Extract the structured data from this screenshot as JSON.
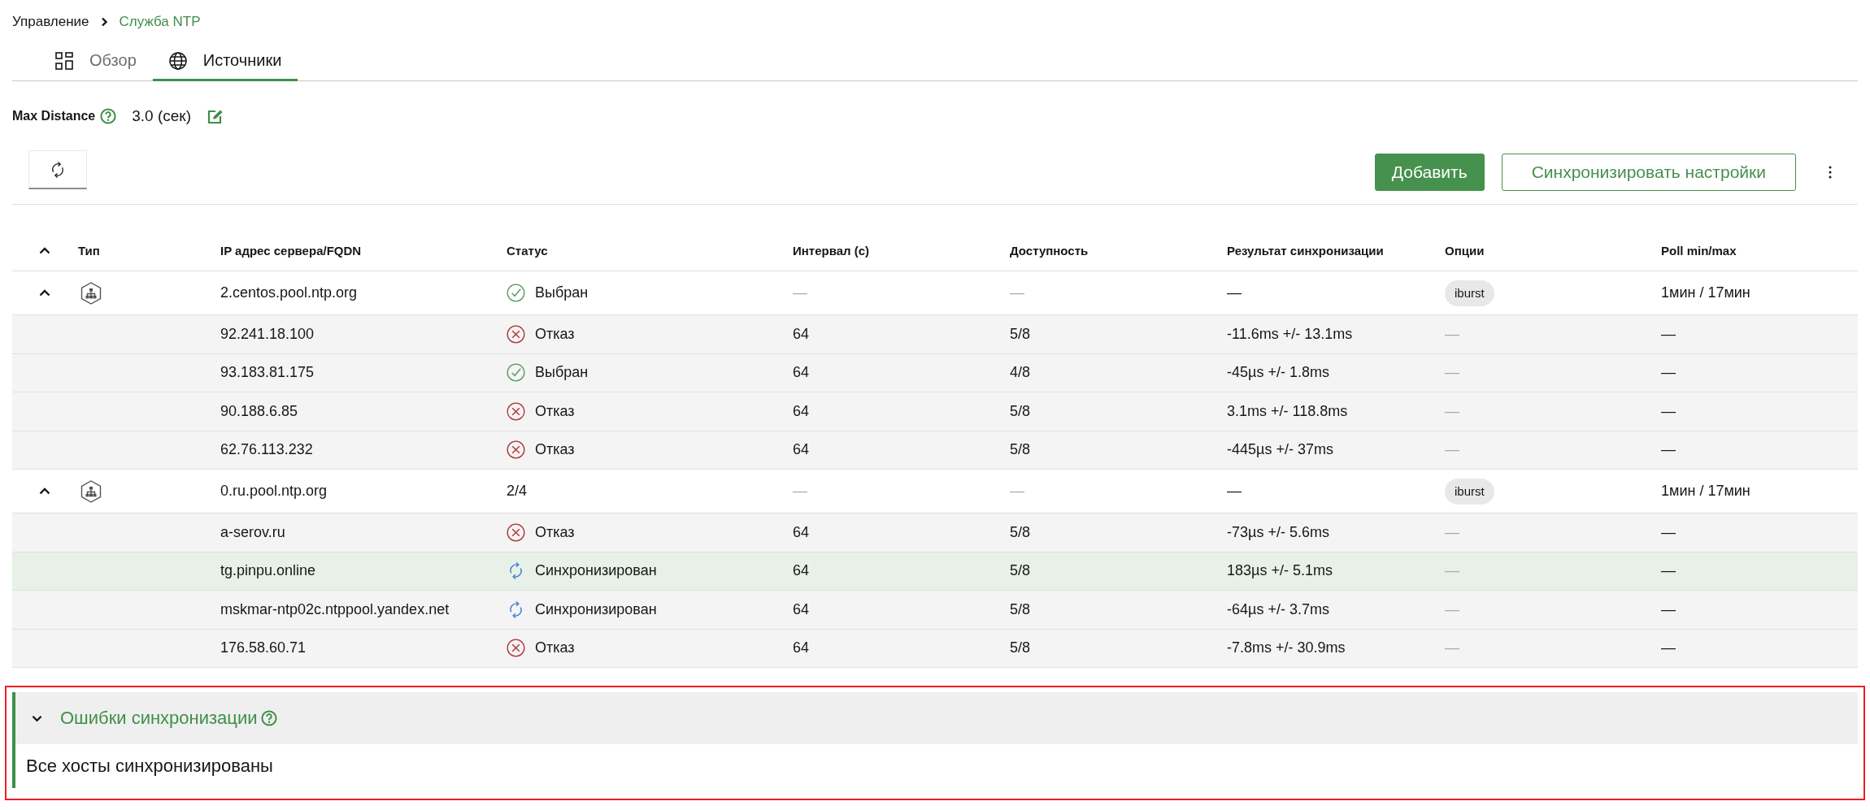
{
  "breadcrumb": [
    {
      "label": "Управление",
      "current": false
    },
    {
      "label": "Служба NTP",
      "current": true
    }
  ],
  "tabs": [
    {
      "kind": "overview",
      "label": "Обзор",
      "selected": false
    },
    {
      "kind": "sources",
      "label": "Источники",
      "selected": true
    }
  ],
  "max_distance": {
    "label": "Max Distance",
    "value": "3.0 (сек)"
  },
  "toolbar": {
    "buttons": [
      {
        "kind": "primary",
        "label": "Добавить"
      },
      {
        "kind": "secondary",
        "label": "Синхронизировать настройки"
      }
    ]
  },
  "table": {
    "columns": [
      "Тип",
      "IP адрес сервера/FQDN",
      "Статус",
      "Интервал (с)",
      "Доступность",
      "Результат синхронизации",
      "Опции",
      "Poll min/max"
    ],
    "rows": [
      {
        "expanded": true,
        "selected": false,
        "host": "2.centos.pool.ntp.org",
        "status": {
          "kind": "selected",
          "label": "Выбран"
        },
        "interval": {
          "text": "—",
          "muted": true
        },
        "availability": {
          "text": "—",
          "muted": true
        },
        "result": {
          "text": "—",
          "muted": false
        },
        "options": {
          "tags": [
            "iburst"
          ]
        },
        "poll": {
          "text": "1мин / 17мин",
          "muted": false
        },
        "children": [
          {
            "selected": false,
            "host": "92.241.18.100",
            "status": {
              "kind": "failed",
              "label": "Отказ"
            },
            "interval": {
              "text": "64",
              "muted": false
            },
            "availability": {
              "text": "5/8",
              "muted": false
            },
            "result": {
              "text": "-11.6ms +/- 13.1ms",
              "muted": false
            },
            "options": {
              "text": "—",
              "muted": true
            },
            "poll": {
              "text": "—",
              "muted": false
            }
          },
          {
            "selected": false,
            "host": "93.183.81.175",
            "status": {
              "kind": "selected",
              "label": "Выбран"
            },
            "interval": {
              "text": "64",
              "muted": false
            },
            "availability": {
              "text": "4/8",
              "muted": false
            },
            "result": {
              "text": "-45µs +/- 1.8ms",
              "muted": false
            },
            "options": {
              "text": "—",
              "muted": true
            },
            "poll": {
              "text": "—",
              "muted": false
            }
          },
          {
            "selected": false,
            "host": "90.188.6.85",
            "status": {
              "kind": "failed",
              "label": "Отказ"
            },
            "interval": {
              "text": "64",
              "muted": false
            },
            "availability": {
              "text": "5/8",
              "muted": false
            },
            "result": {
              "text": "3.1ms +/- 118.8ms",
              "muted": false
            },
            "options": {
              "text": "—",
              "muted": true
            },
            "poll": {
              "text": "—",
              "muted": false
            }
          },
          {
            "selected": false,
            "host": "62.76.113.232",
            "status": {
              "kind": "failed",
              "label": "Отказ"
            },
            "interval": {
              "text": "64",
              "muted": false
            },
            "availability": {
              "text": "5/8",
              "muted": false
            },
            "result": {
              "text": "-445µs +/- 37ms",
              "muted": false
            },
            "options": {
              "text": "—",
              "muted": true
            },
            "poll": {
              "text": "—",
              "muted": false
            }
          }
        ]
      },
      {
        "expanded": true,
        "selected": false,
        "host": "0.ru.pool.ntp.org",
        "status": {
          "kind": "count",
          "label": "2/4"
        },
        "interval": {
          "text": "—",
          "muted": true
        },
        "availability": {
          "text": "—",
          "muted": true
        },
        "result": {
          "text": "—",
          "muted": false
        },
        "options": {
          "tags": [
            "iburst"
          ]
        },
        "poll": {
          "text": "1мин / 17мин",
          "muted": false
        },
        "children": [
          {
            "selected": false,
            "host": "a-serov.ru",
            "status": {
              "kind": "failed",
              "label": "Отказ"
            },
            "interval": {
              "text": "64",
              "muted": false
            },
            "availability": {
              "text": "5/8",
              "muted": false
            },
            "result": {
              "text": "-73µs +/- 5.6ms",
              "muted": false
            },
            "options": {
              "text": "—",
              "muted": true
            },
            "poll": {
              "text": "—",
              "muted": false
            }
          },
          {
            "selected": true,
            "host": "tg.pinpu.online",
            "status": {
              "kind": "synced",
              "label": "Синхронизирован"
            },
            "interval": {
              "text": "64",
              "muted": false
            },
            "availability": {
              "text": "5/8",
              "muted": false
            },
            "result": {
              "text": "183µs +/- 5.1ms",
              "muted": false
            },
            "options": {
              "text": "—",
              "muted": true
            },
            "poll": {
              "text": "—",
              "muted": false
            }
          },
          {
            "selected": false,
            "host": "mskmar-ntp02c.ntppool.yandex.net",
            "status": {
              "kind": "synced",
              "label": "Синхронизирован"
            },
            "interval": {
              "text": "64",
              "muted": false
            },
            "availability": {
              "text": "5/8",
              "muted": false
            },
            "result": {
              "text": "-64µs +/- 3.7ms",
              "muted": false
            },
            "options": {
              "text": "—",
              "muted": true
            },
            "poll": {
              "text": "—",
              "muted": false
            }
          },
          {
            "selected": false,
            "host": "176.58.60.71",
            "status": {
              "kind": "failed",
              "label": "Отказ"
            },
            "interval": {
              "text": "64",
              "muted": false
            },
            "availability": {
              "text": "5/8",
              "muted": false
            },
            "result": {
              "text": "-7.8ms +/- 30.9ms",
              "muted": false
            },
            "options": {
              "text": "—",
              "muted": true
            },
            "poll": {
              "text": "—",
              "muted": false
            }
          }
        ]
      }
    ]
  },
  "errors_panel": {
    "highlighted": true,
    "expanded": true,
    "title": "Ошибки синхронизации",
    "message": "Все хосты синхронизированы"
  }
}
